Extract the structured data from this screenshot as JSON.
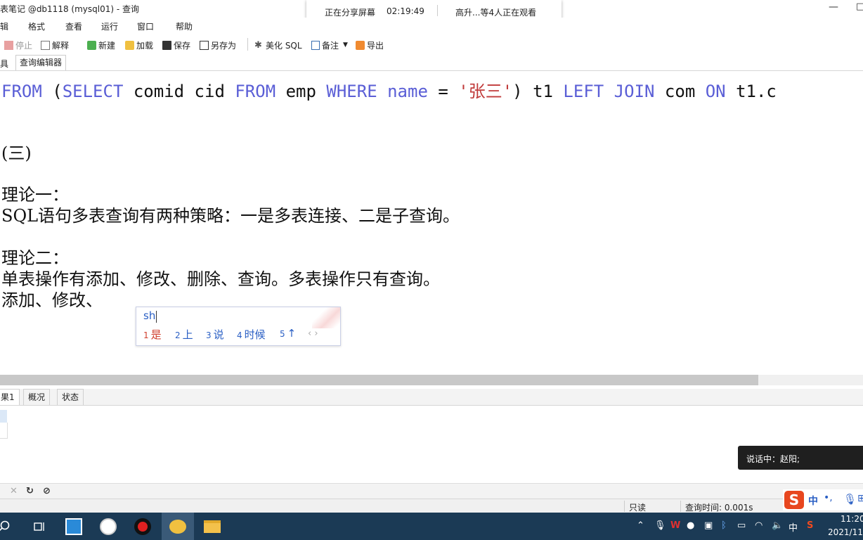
{
  "window": {
    "title": "表笔记 @db1118 (mysql01) - 查询",
    "minimize_label": "—",
    "extra_glyph": "□"
  },
  "share_banner": {
    "status": "正在分享屏幕",
    "time": "02:19:49",
    "viewers": "高升...等4人正在观看"
  },
  "menu": {
    "items": [
      "辑",
      "格式",
      "查看",
      "运行",
      "窗口",
      "帮助"
    ]
  },
  "toolbar": {
    "stop": "停止",
    "explain": "解释",
    "new": "新建",
    "load": "加载",
    "save": "保存",
    "save_as": "另存为",
    "beautify": "美化 SQL",
    "notes": "备注",
    "export": "导出"
  },
  "tabs": {
    "tools": "具",
    "editor": "查询编辑器"
  },
  "editor": {
    "sql_tokens": [
      {
        "t": "FROM",
        "c": "kw"
      },
      {
        "t": " (",
        "c": ""
      },
      {
        "t": "SELECT",
        "c": "kw"
      },
      {
        "t": " comid cid ",
        "c": ""
      },
      {
        "t": "FROM",
        "c": "kw"
      },
      {
        "t": " emp ",
        "c": ""
      },
      {
        "t": "WHERE",
        "c": "kw"
      },
      {
        "t": " ",
        "c": ""
      },
      {
        "t": "name",
        "c": "kw"
      },
      {
        "t": " = ",
        "c": ""
      },
      {
        "t": "'张三'",
        "c": "str"
      },
      {
        "t": ") t1 ",
        "c": ""
      },
      {
        "t": "LEFT",
        "c": "kw"
      },
      {
        "t": " ",
        "c": ""
      },
      {
        "t": "JOIN",
        "c": "kw"
      },
      {
        "t": " com ",
        "c": ""
      },
      {
        "t": "ON",
        "c": "kw"
      },
      {
        "t": " t1.c",
        "c": ""
      }
    ],
    "line_section": "(三)",
    "line_theory1": "理论一：",
    "line_theory1_body": "SQL语句多表查询有两种策略：一是多表连接、二是子查询。",
    "line_theory2": "理论二：",
    "line_theory2_body": "单表操作有添加、修改、删除、查询。多表操作只有查询。",
    "line_current": "添加、修改、"
  },
  "ime_popup": {
    "input": "sh",
    "candidates": [
      {
        "num": "1",
        "text": "是"
      },
      {
        "num": "2",
        "text": "上"
      },
      {
        "num": "3",
        "text": "说"
      },
      {
        "num": "4",
        "text": "时候"
      },
      {
        "num": "5",
        "text": "↑"
      }
    ],
    "page_arrows": "‹ ›"
  },
  "result_tabs": [
    "果1",
    "概况",
    "状态"
  ],
  "status_bar": {
    "read_only": "只读",
    "query_time": "查询时间: 0.001s"
  },
  "speaking": {
    "text": "说话中：赵阳;"
  },
  "ime_bar": {
    "logo": "S",
    "mode": "中",
    "punct": "•,",
    "mic": "🎙",
    "more": "⊞"
  },
  "taskbar": {
    "tray_lang": "中",
    "time": "11:20",
    "date": "2021/11/"
  }
}
